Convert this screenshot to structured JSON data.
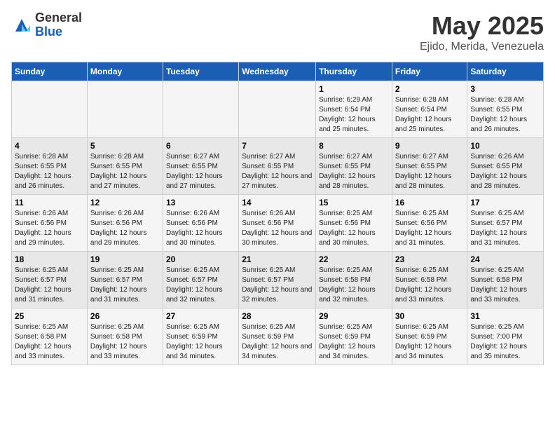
{
  "logo": {
    "general": "General",
    "blue": "Blue"
  },
  "title": {
    "month": "May 2025",
    "location": "Ejido, Merida, Venezuela"
  },
  "weekdays": [
    "Sunday",
    "Monday",
    "Tuesday",
    "Wednesday",
    "Thursday",
    "Friday",
    "Saturday"
  ],
  "weeks": [
    [
      {
        "day": "",
        "sunrise": "",
        "sunset": "",
        "daylight": ""
      },
      {
        "day": "",
        "sunrise": "",
        "sunset": "",
        "daylight": ""
      },
      {
        "day": "",
        "sunrise": "",
        "sunset": "",
        "daylight": ""
      },
      {
        "day": "",
        "sunrise": "",
        "sunset": "",
        "daylight": ""
      },
      {
        "day": "1",
        "sunrise": "Sunrise: 6:29 AM",
        "sunset": "Sunset: 6:54 PM",
        "daylight": "Daylight: 12 hours and 25 minutes."
      },
      {
        "day": "2",
        "sunrise": "Sunrise: 6:28 AM",
        "sunset": "Sunset: 6:54 PM",
        "daylight": "Daylight: 12 hours and 25 minutes."
      },
      {
        "day": "3",
        "sunrise": "Sunrise: 6:28 AM",
        "sunset": "Sunset: 6:55 PM",
        "daylight": "Daylight: 12 hours and 26 minutes."
      }
    ],
    [
      {
        "day": "4",
        "sunrise": "Sunrise: 6:28 AM",
        "sunset": "Sunset: 6:55 PM",
        "daylight": "Daylight: 12 hours and 26 minutes."
      },
      {
        "day": "5",
        "sunrise": "Sunrise: 6:28 AM",
        "sunset": "Sunset: 6:55 PM",
        "daylight": "Daylight: 12 hours and 27 minutes."
      },
      {
        "day": "6",
        "sunrise": "Sunrise: 6:27 AM",
        "sunset": "Sunset: 6:55 PM",
        "daylight": "Daylight: 12 hours and 27 minutes."
      },
      {
        "day": "7",
        "sunrise": "Sunrise: 6:27 AM",
        "sunset": "Sunset: 6:55 PM",
        "daylight": "Daylight: 12 hours and 27 minutes."
      },
      {
        "day": "8",
        "sunrise": "Sunrise: 6:27 AM",
        "sunset": "Sunset: 6:55 PM",
        "daylight": "Daylight: 12 hours and 28 minutes."
      },
      {
        "day": "9",
        "sunrise": "Sunrise: 6:27 AM",
        "sunset": "Sunset: 6:55 PM",
        "daylight": "Daylight: 12 hours and 28 minutes."
      },
      {
        "day": "10",
        "sunrise": "Sunrise: 6:26 AM",
        "sunset": "Sunset: 6:55 PM",
        "daylight": "Daylight: 12 hours and 28 minutes."
      }
    ],
    [
      {
        "day": "11",
        "sunrise": "Sunrise: 6:26 AM",
        "sunset": "Sunset: 6:56 PM",
        "daylight": "Daylight: 12 hours and 29 minutes."
      },
      {
        "day": "12",
        "sunrise": "Sunrise: 6:26 AM",
        "sunset": "Sunset: 6:56 PM",
        "daylight": "Daylight: 12 hours and 29 minutes."
      },
      {
        "day": "13",
        "sunrise": "Sunrise: 6:26 AM",
        "sunset": "Sunset: 6:56 PM",
        "daylight": "Daylight: 12 hours and 30 minutes."
      },
      {
        "day": "14",
        "sunrise": "Sunrise: 6:26 AM",
        "sunset": "Sunset: 6:56 PM",
        "daylight": "Daylight: 12 hours and 30 minutes."
      },
      {
        "day": "15",
        "sunrise": "Sunrise: 6:25 AM",
        "sunset": "Sunset: 6:56 PM",
        "daylight": "Daylight: 12 hours and 30 minutes."
      },
      {
        "day": "16",
        "sunrise": "Sunrise: 6:25 AM",
        "sunset": "Sunset: 6:56 PM",
        "daylight": "Daylight: 12 hours and 31 minutes."
      },
      {
        "day": "17",
        "sunrise": "Sunrise: 6:25 AM",
        "sunset": "Sunset: 6:57 PM",
        "daylight": "Daylight: 12 hours and 31 minutes."
      }
    ],
    [
      {
        "day": "18",
        "sunrise": "Sunrise: 6:25 AM",
        "sunset": "Sunset: 6:57 PM",
        "daylight": "Daylight: 12 hours and 31 minutes."
      },
      {
        "day": "19",
        "sunrise": "Sunrise: 6:25 AM",
        "sunset": "Sunset: 6:57 PM",
        "daylight": "Daylight: 12 hours and 31 minutes."
      },
      {
        "day": "20",
        "sunrise": "Sunrise: 6:25 AM",
        "sunset": "Sunset: 6:57 PM",
        "daylight": "Daylight: 12 hours and 32 minutes."
      },
      {
        "day": "21",
        "sunrise": "Sunrise: 6:25 AM",
        "sunset": "Sunset: 6:57 PM",
        "daylight": "Daylight: 12 hours and 32 minutes."
      },
      {
        "day": "22",
        "sunrise": "Sunrise: 6:25 AM",
        "sunset": "Sunset: 6:58 PM",
        "daylight": "Daylight: 12 hours and 32 minutes."
      },
      {
        "day": "23",
        "sunrise": "Sunrise: 6:25 AM",
        "sunset": "Sunset: 6:58 PM",
        "daylight": "Daylight: 12 hours and 33 minutes."
      },
      {
        "day": "24",
        "sunrise": "Sunrise: 6:25 AM",
        "sunset": "Sunset: 6:58 PM",
        "daylight": "Daylight: 12 hours and 33 minutes."
      }
    ],
    [
      {
        "day": "25",
        "sunrise": "Sunrise: 6:25 AM",
        "sunset": "Sunset: 6:58 PM",
        "daylight": "Daylight: 12 hours and 33 minutes."
      },
      {
        "day": "26",
        "sunrise": "Sunrise: 6:25 AM",
        "sunset": "Sunset: 6:58 PM",
        "daylight": "Daylight: 12 hours and 33 minutes."
      },
      {
        "day": "27",
        "sunrise": "Sunrise: 6:25 AM",
        "sunset": "Sunset: 6:59 PM",
        "daylight": "Daylight: 12 hours and 34 minutes."
      },
      {
        "day": "28",
        "sunrise": "Sunrise: 6:25 AM",
        "sunset": "Sunset: 6:59 PM",
        "daylight": "Daylight: 12 hours and 34 minutes."
      },
      {
        "day": "29",
        "sunrise": "Sunrise: 6:25 AM",
        "sunset": "Sunset: 6:59 PM",
        "daylight": "Daylight: 12 hours and 34 minutes."
      },
      {
        "day": "30",
        "sunrise": "Sunrise: 6:25 AM",
        "sunset": "Sunset: 6:59 PM",
        "daylight": "Daylight: 12 hours and 34 minutes."
      },
      {
        "day": "31",
        "sunrise": "Sunrise: 6:25 AM",
        "sunset": "Sunset: 7:00 PM",
        "daylight": "Daylight: 12 hours and 35 minutes."
      }
    ]
  ]
}
